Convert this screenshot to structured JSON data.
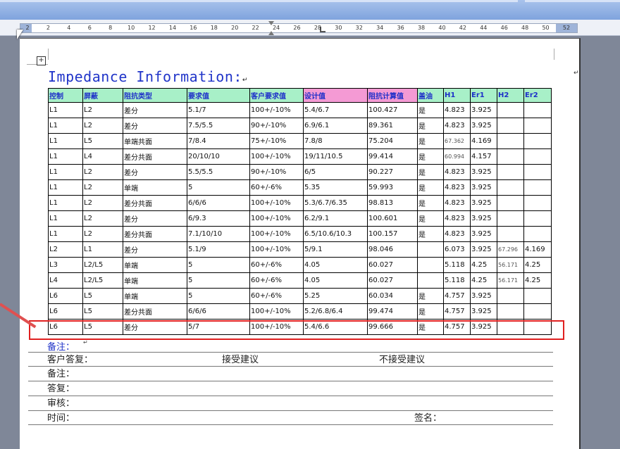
{
  "ruler": {
    "ticks": [
      "2",
      "2",
      "4",
      "6",
      "8",
      "10",
      "12",
      "14",
      "16",
      "18",
      "20",
      "22",
      "24",
      "26",
      "28",
      "30",
      "32",
      "34",
      "36",
      "38",
      "40",
      "42",
      "44",
      "46",
      "48",
      "50",
      "52"
    ]
  },
  "doc": {
    "title": "Impedance Information:",
    "headers": [
      "控制",
      "屏蔽",
      "阻抗类型",
      "要求值",
      "客户要求值",
      "设计值",
      "阻抗计算值",
      "盖油",
      "H1",
      "Er1",
      "H2",
      "Er2"
    ],
    "rows": [
      [
        "L1",
        "L2",
        "差分",
        "5.1/7",
        "100+/-10%",
        "5.4/6.7",
        "100.427",
        "是",
        "4.823",
        "3.925",
        "",
        ""
      ],
      [
        "L1",
        "L2",
        "差分",
        "7.5/5.5",
        "90+/-10%",
        "6.9/6.1",
        "89.361",
        "是",
        "4.823",
        "3.925",
        "",
        ""
      ],
      [
        "L1",
        "L5",
        "单端共面",
        "7/8.4",
        "75+/-10%",
        "7.8/8",
        "75.204",
        "是",
        "67.362",
        "4.169",
        "",
        ""
      ],
      [
        "L1",
        "L4",
        "差分共面",
        "20/10/10",
        "100+/-10%",
        "19/11/10.5",
        "99.414",
        "是",
        "60.994",
        "4.157",
        "",
        ""
      ],
      [
        "L1",
        "L2",
        "差分",
        "5.5/5.5",
        "90+/-10%",
        "6/5",
        "90.227",
        "是",
        "4.823",
        "3.925",
        "",
        ""
      ],
      [
        "L1",
        "L2",
        "单端",
        "5",
        "60+/-6%",
        "5.35",
        "59.993",
        "是",
        "4.823",
        "3.925",
        "",
        ""
      ],
      [
        "L1",
        "L2",
        "差分共面",
        "6/6/6",
        "100+/-10%",
        "5.3/6.7/6.35",
        "98.813",
        "是",
        "4.823",
        "3.925",
        "",
        ""
      ],
      [
        "L1",
        "L2",
        "差分",
        "6/9.3",
        "100+/-10%",
        "6.2/9.1",
        "100.601",
        "是",
        "4.823",
        "3.925",
        "",
        ""
      ],
      [
        "L1",
        "L2",
        "差分共面",
        "7.1/10/10",
        "100+/-10%",
        "6.5/10.6/10.3",
        "100.157",
        "是",
        "4.823",
        "3.925",
        "",
        ""
      ],
      [
        "L2",
        "L1",
        "差分",
        "5.1/9",
        "100+/-10%",
        "5/9.1",
        "98.046",
        "",
        "6.073",
        "3.925",
        "67.296",
        "4.169"
      ],
      [
        "L3",
        "L2/L5",
        "单端",
        "5",
        "60+/-6%",
        "4.05",
        "60.027",
        "",
        "5.118",
        "4.25",
        "56.171",
        "4.25"
      ],
      [
        "L4",
        "L2/L5",
        "单端",
        "5",
        "60+/-6%",
        "4.05",
        "60.027",
        "",
        "5.118",
        "4.25",
        "56.171",
        "4.25"
      ],
      [
        "L6",
        "L5",
        "单端",
        "5",
        "60+/-6%",
        "5.25",
        "60.034",
        "是",
        "4.757",
        "3.925",
        "",
        ""
      ],
      [
        "L6",
        "L5",
        "差分共面",
        "6/6/6",
        "100+/-10%",
        "5.2/6.8/6.4",
        "99.474",
        "是",
        "4.757",
        "3.925",
        "",
        ""
      ],
      [
        "L6",
        "L5",
        "差分",
        "5/7",
        "100+/-10%",
        "5.4/6.6",
        "99.666",
        "是",
        "4.757",
        "3.925",
        "",
        ""
      ]
    ],
    "remark_label": "备注：",
    "customer_reply_label": "客户答复：",
    "accept": "接受建议",
    "reject": "不接受建议",
    "remark2_label": "备注：",
    "reply_label": "答复：",
    "review_label": "审核：",
    "time_label": "时间：",
    "sign_label": "签名："
  },
  "colors": {
    "header_bg": "#a8f0c8",
    "header_pink": "#f49ad4",
    "title_blue": "#2135c9",
    "highlight": "#e02020"
  }
}
